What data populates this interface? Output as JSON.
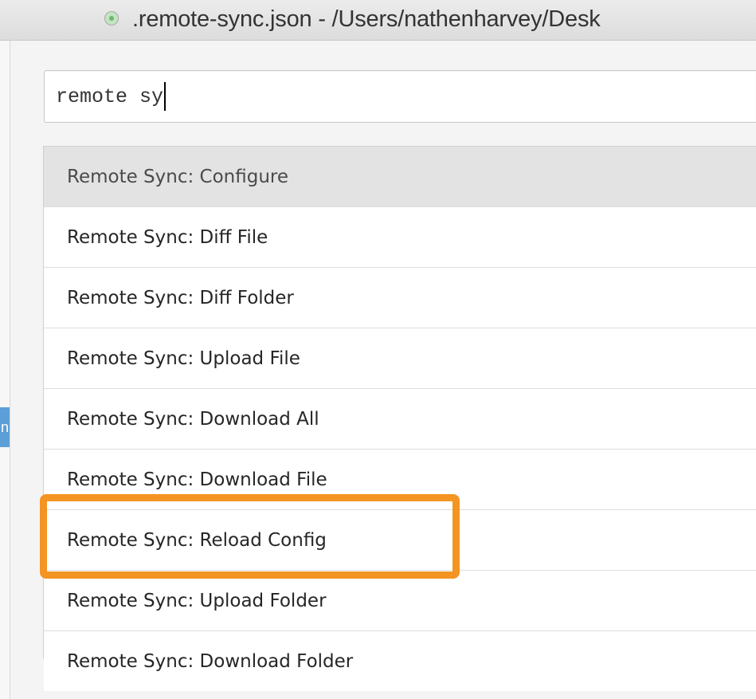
{
  "window": {
    "title": ".remote-sync.json - /Users/nathenharvey/Desk",
    "file_icon": "file-status-icon",
    "left_tab_glyph": "n"
  },
  "search": {
    "value": "remote sy"
  },
  "commands": [
    {
      "label": "Remote Sync: Configure",
      "selected": true
    },
    {
      "label": "Remote Sync: Diff File"
    },
    {
      "label": "Remote Sync: Diff Folder"
    },
    {
      "label": "Remote Sync: Upload File"
    },
    {
      "label": "Remote Sync: Download All"
    },
    {
      "label": "Remote Sync: Download File"
    },
    {
      "label": "Remote Sync: Reload Config",
      "highlighted": true
    },
    {
      "label": "Remote Sync: Upload Folder"
    },
    {
      "label": "Remote Sync: Download Folder"
    }
  ],
  "colors": {
    "highlight": "#f49422",
    "selected_row": "#e3e3e3",
    "left_tab": "#5c9ed6"
  }
}
